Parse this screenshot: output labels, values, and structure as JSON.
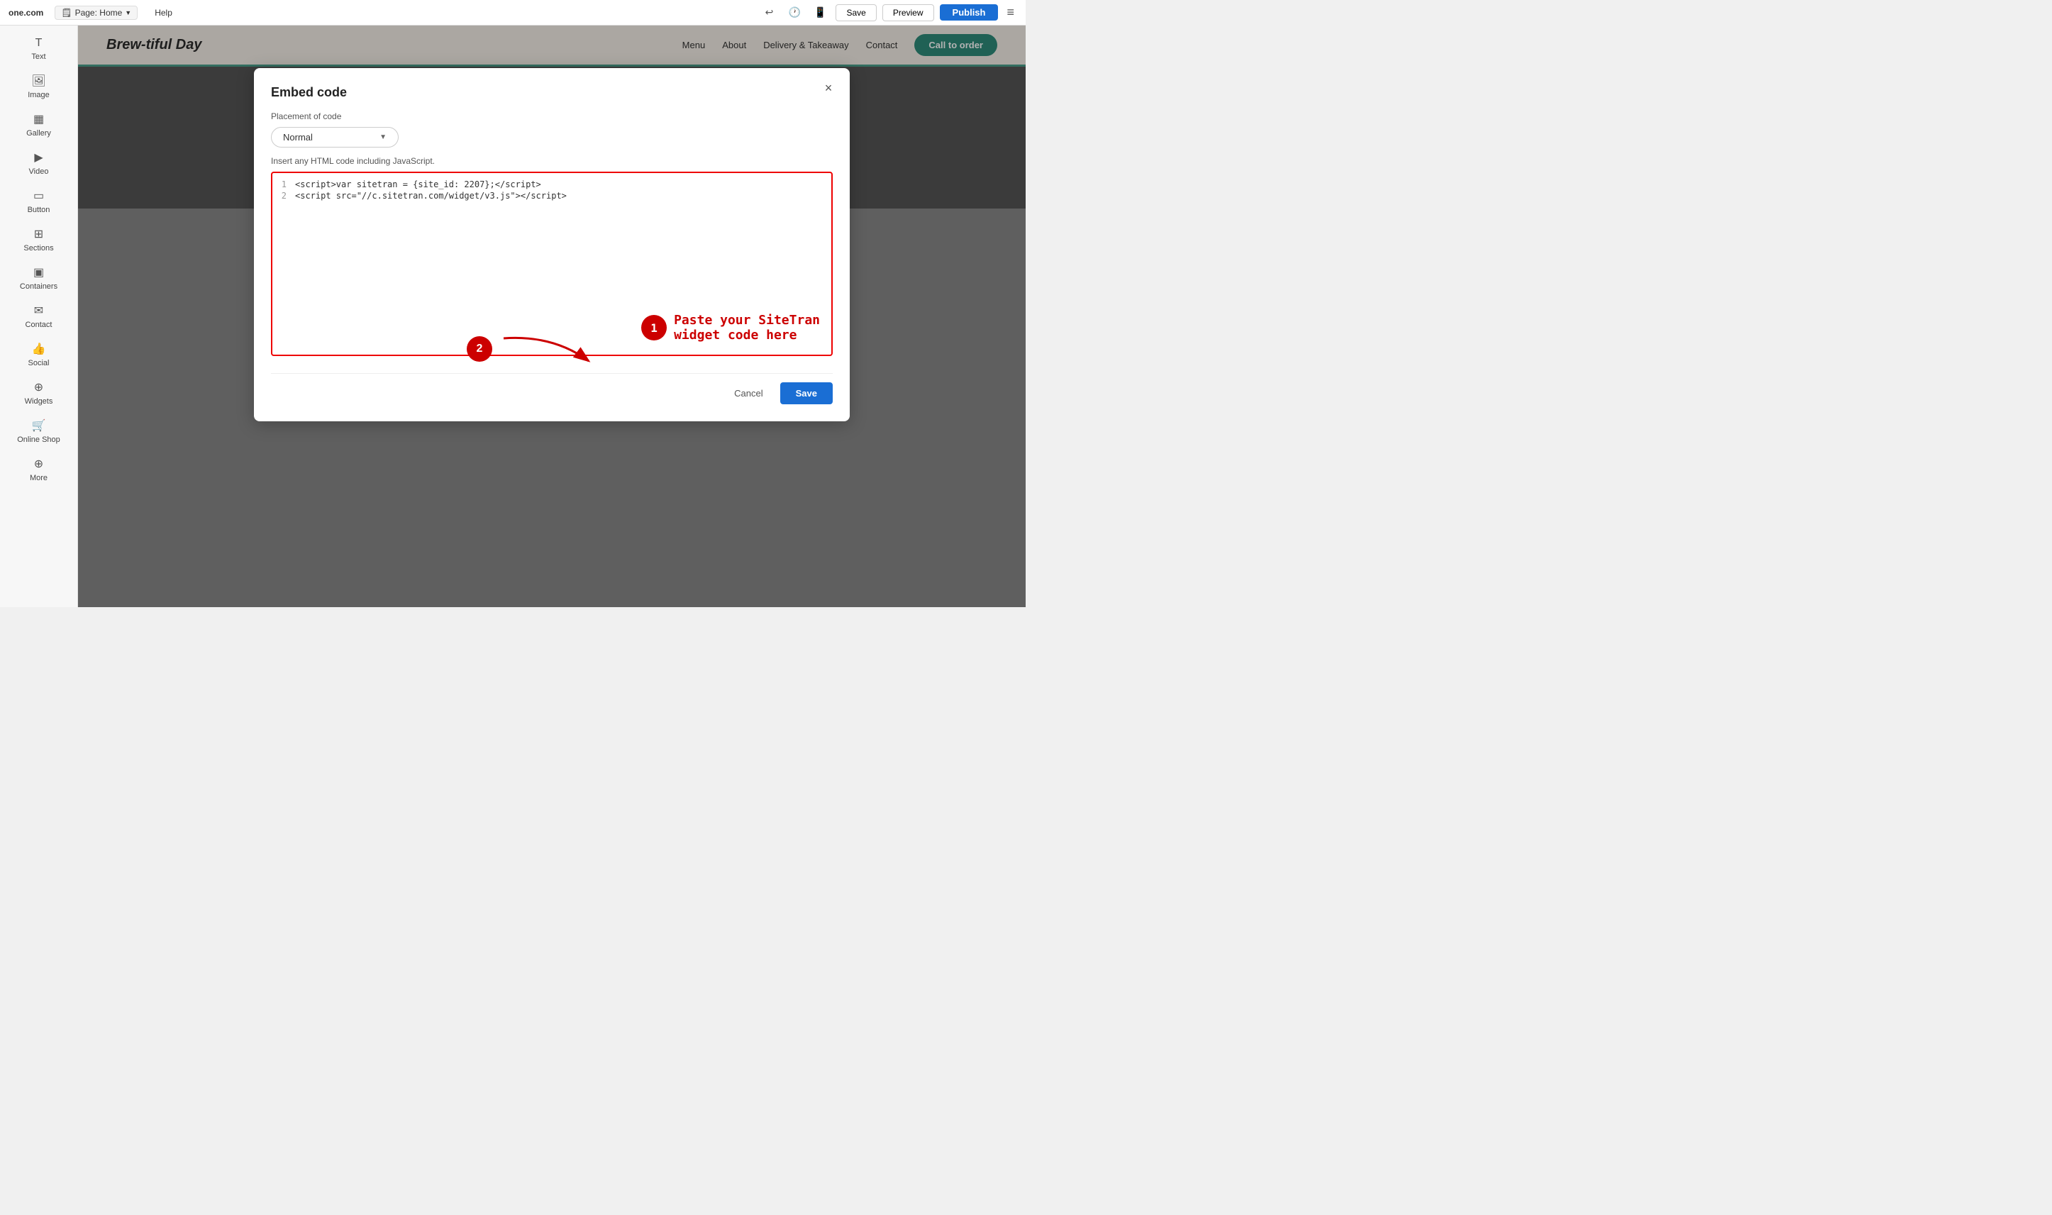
{
  "topbar": {
    "logo": "one.com",
    "page_label": "Page: Home",
    "help_label": "Help",
    "save_label": "Save",
    "preview_label": "Preview",
    "publish_label": "Publish"
  },
  "sidebar": {
    "items": [
      {
        "id": "text",
        "icon": "T",
        "label": "Text"
      },
      {
        "id": "image",
        "icon": "🖼",
        "label": "Image"
      },
      {
        "id": "gallery",
        "icon": "▦",
        "label": "Gallery"
      },
      {
        "id": "video",
        "icon": "▶",
        "label": "Video"
      },
      {
        "id": "button",
        "icon": "▭",
        "label": "Button"
      },
      {
        "id": "sections",
        "icon": "⊞",
        "label": "Sections"
      },
      {
        "id": "containers",
        "icon": "▣",
        "label": "Containers"
      },
      {
        "id": "contact",
        "icon": "✉",
        "label": "Contact"
      },
      {
        "id": "social",
        "icon": "👍",
        "label": "Social"
      },
      {
        "id": "widgets",
        "icon": "⊕",
        "label": "Widgets"
      },
      {
        "id": "online-shop",
        "icon": "🛒",
        "label": "Online Shop"
      },
      {
        "id": "more",
        "icon": "⊕",
        "label": "More"
      }
    ]
  },
  "preview": {
    "brand": "Brew-tiful Day",
    "nav": [
      "Menu",
      "About",
      "Delivery & Takeaway",
      "Contact"
    ],
    "cta": "Call to order"
  },
  "modal": {
    "title": "Embed code",
    "close_label": "×",
    "placement_label": "Placement of code",
    "placement_value": "Normal",
    "insert_note": "Insert any HTML code including JavaScript.",
    "code_lines": [
      {
        "num": "1",
        "content": "<script>var sitetran = {site_id: 2207};<\\/script>"
      },
      {
        "num": "2",
        "content": "<script src=\"//c.sitetran.com/widget/v3.js\"><\\/script>"
      }
    ],
    "annotation1_num": "1",
    "annotation1_text": "Paste your SiteTran\nwidget code here",
    "annotation2_num": "2",
    "cancel_label": "Cancel",
    "save_label": "Save"
  }
}
